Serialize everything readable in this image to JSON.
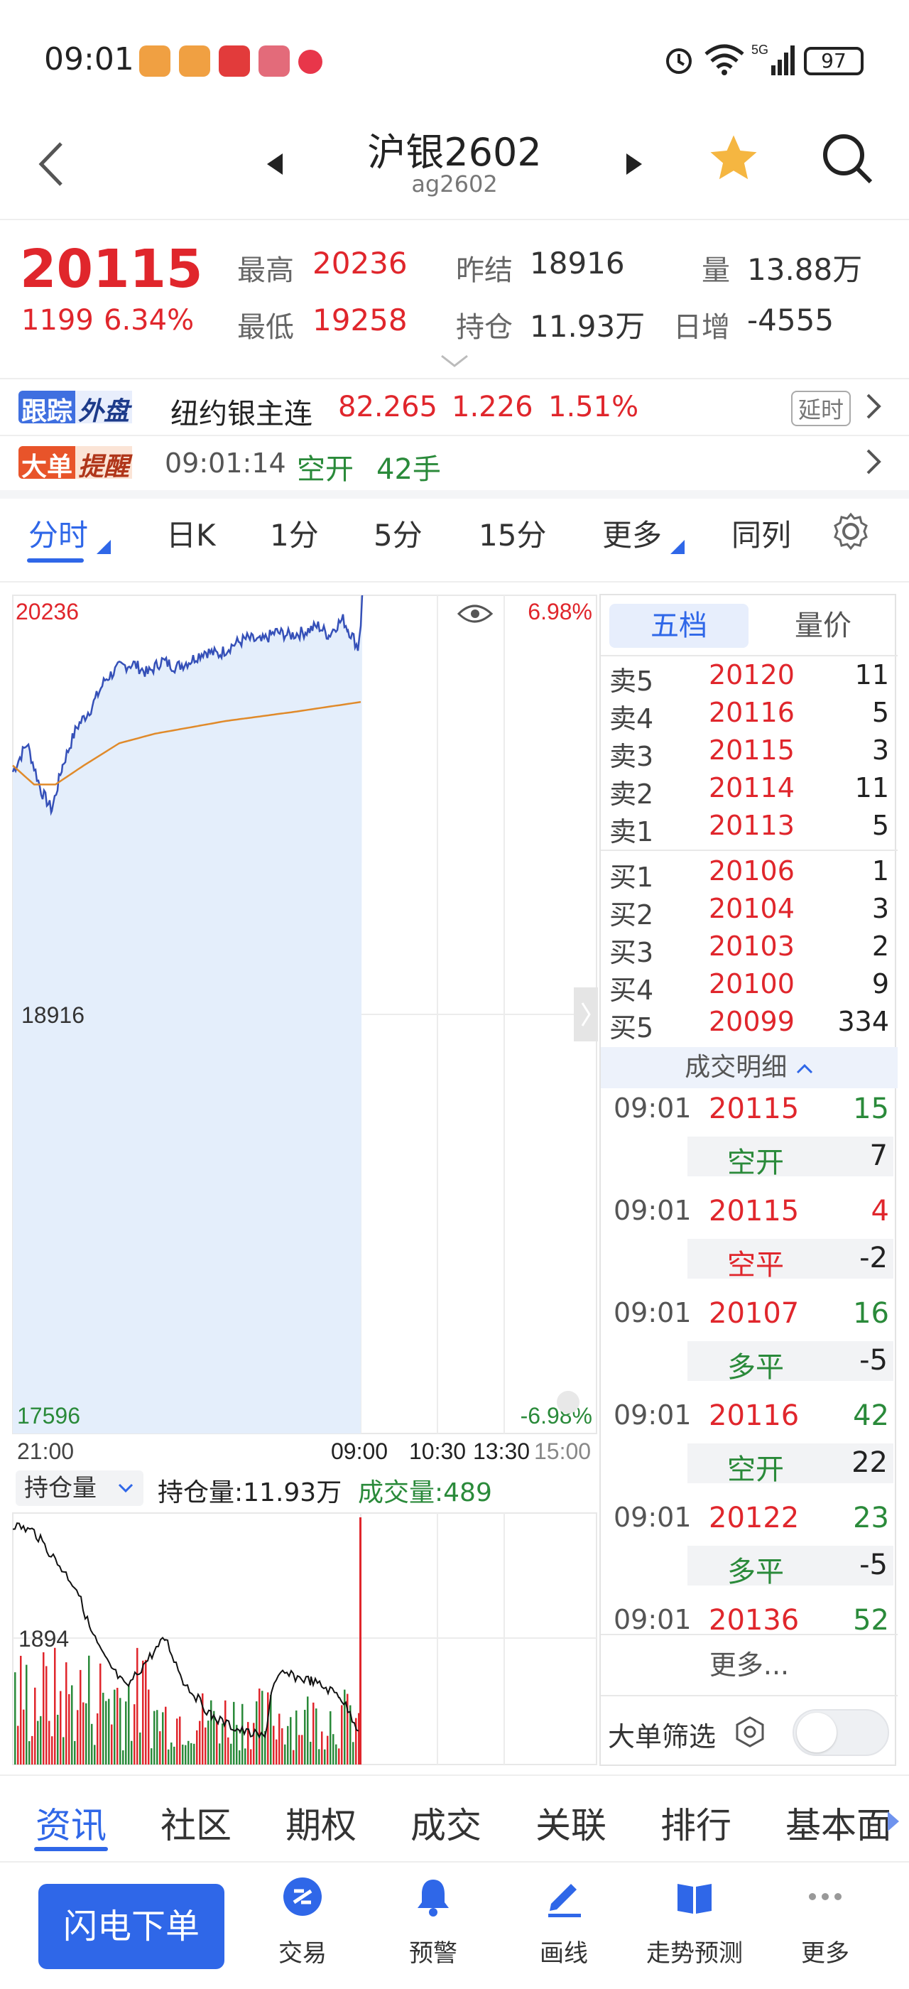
{
  "status": {
    "time": "09:01",
    "battery": "97"
  },
  "nav": {
    "title": "沪银2602",
    "subtitle": "ag2602"
  },
  "quote": {
    "last": "20115",
    "change": "1199",
    "change_pct": "6.34%",
    "high_label": "最高",
    "high": "20236",
    "low_label": "最低",
    "low": "19258",
    "prev_settle_label": "昨结",
    "prev_settle": "18916",
    "oi_label": "持仓",
    "oi": "11.93万",
    "vol_label": "量",
    "vol": "13.88万",
    "daily_inc_label": "日增",
    "daily_inc": "-4555"
  },
  "foreign": {
    "badge_a": "跟踪",
    "badge_b": "外盘",
    "name": "纽约银主连",
    "price": "82.265",
    "change": "1.226",
    "pct": "1.51%",
    "delay": "延时"
  },
  "bigorder": {
    "badge_a": "大单",
    "badge_b": "提醒",
    "time": "09:01:14",
    "type": "空开",
    "qty": "42手"
  },
  "chart_tabs": [
    "分时",
    "日K",
    "1分",
    "5分",
    "15分",
    "更多",
    "同列"
  ],
  "chart": {
    "y_top": "20236",
    "y_mid": "18916",
    "y_bottom": "17596",
    "pct_top": "6.98%",
    "pct_bottom": "-6.98%",
    "x_labels": [
      "21:00",
      "09:00",
      "10:30",
      "13:30",
      "15:00"
    ],
    "vol_selector": "持仓量",
    "oi_text": "持仓量:11.93万",
    "volume_text": "成交量:489",
    "vol_axis": "1894"
  },
  "orderbook": {
    "tab_a": "五档",
    "tab_b": "量价",
    "asks": [
      {
        "label": "卖5",
        "price": "20120",
        "qty": "11"
      },
      {
        "label": "卖4",
        "price": "20116",
        "qty": "5"
      },
      {
        "label": "卖3",
        "price": "20115",
        "qty": "3"
      },
      {
        "label": "卖2",
        "price": "20114",
        "qty": "11"
      },
      {
        "label": "卖1",
        "price": "20113",
        "qty": "5"
      }
    ],
    "bids": [
      {
        "label": "买1",
        "price": "20106",
        "qty": "1"
      },
      {
        "label": "买2",
        "price": "20104",
        "qty": "3"
      },
      {
        "label": "买3",
        "price": "20103",
        "qty": "2"
      },
      {
        "label": "买4",
        "price": "20100",
        "qty": "9"
      },
      {
        "label": "买5",
        "price": "20099",
        "qty": "334"
      }
    ],
    "trades_header": "成交明细",
    "trades": [
      {
        "time": "09:01",
        "price": "20115",
        "qty": "15",
        "type": "空开",
        "net": "7"
      },
      {
        "time": "09:01",
        "price": "20115",
        "qty": "4",
        "type": "空平",
        "net": "-2"
      },
      {
        "time": "09:01",
        "price": "20107",
        "qty": "16",
        "type": "多平",
        "net": "-5"
      },
      {
        "time": "09:01",
        "price": "20116",
        "qty": "42",
        "type": "空开",
        "net": "22"
      },
      {
        "time": "09:01",
        "price": "20122",
        "qty": "23",
        "type": "多平",
        "net": "-5"
      },
      {
        "time": "09:01",
        "price": "20136",
        "qty": "52",
        "type": "",
        "net": ""
      }
    ],
    "more": "更多...",
    "filter": "大单筛选"
  },
  "bottom_tabs": [
    "资讯",
    "社区",
    "期权",
    "成交",
    "关联",
    "排行",
    "基本面"
  ],
  "actions": {
    "flash": "闪电下单",
    "items": [
      "交易",
      "预警",
      "画线",
      "走势预测",
      "更多"
    ]
  },
  "colors": {
    "up": "#e0262c",
    "down": "#2a8a3a",
    "accent": "#2f67e8",
    "price_line": "#3550b8",
    "avg_line": "#e08a2a"
  }
}
